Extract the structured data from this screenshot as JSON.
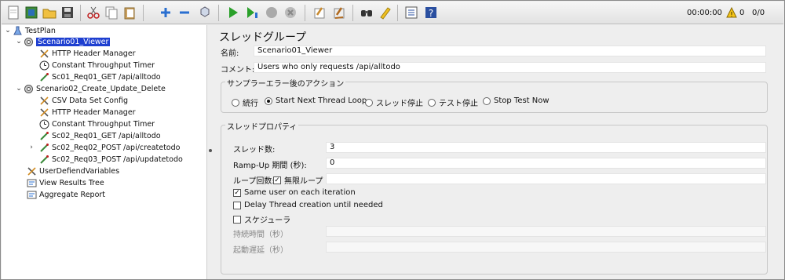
{
  "toolbar": {
    "buttons": [
      {
        "name": "new-icon"
      },
      {
        "name": "templates-icon"
      },
      {
        "name": "open-icon"
      },
      {
        "name": "save-icon"
      },
      {
        "name": "cut-icon"
      },
      {
        "name": "copy-icon"
      },
      {
        "name": "paste-icon"
      },
      {
        "name": "expand-icon"
      },
      {
        "name": "collapse-icon"
      },
      {
        "name": "toggle-icon"
      },
      {
        "name": "start-icon"
      },
      {
        "name": "start-no-pauses-icon"
      },
      {
        "name": "stop-icon"
      },
      {
        "name": "shutdown-icon"
      },
      {
        "name": "clear-icon"
      },
      {
        "name": "clear-all-icon"
      },
      {
        "name": "search-icon"
      },
      {
        "name": "reset-search-icon"
      },
      {
        "name": "function-helper-icon"
      },
      {
        "name": "help-icon"
      }
    ],
    "timer": "00:00:00",
    "warning_count": "0",
    "threads": "0/0"
  },
  "tree": {
    "nodes": [
      {
        "label": "TestPlan",
        "icon": "test-plan-icon"
      },
      {
        "label": "Scenario01_Viewer",
        "icon": "thread-group-icon"
      },
      {
        "label": "HTTP Header Manager",
        "icon": "config-element-icon"
      },
      {
        "label": "Constant Throughput Timer",
        "icon": "timer-icon"
      },
      {
        "label": "Sc01_Req01_GET /api/alltodo",
        "icon": "sampler-icon"
      },
      {
        "label": "Scenario02_Create_Update_Delete",
        "icon": "thread-group-icon"
      },
      {
        "label": "CSV Data Set Config",
        "icon": "config-element-icon"
      },
      {
        "label": "HTTP Header Manager",
        "icon": "config-element-icon"
      },
      {
        "label": "Constant Throughput Timer",
        "icon": "timer-icon"
      },
      {
        "label": "Sc02_Req01_GET /api/alltodo",
        "icon": "sampler-icon"
      },
      {
        "label": "Sc02_Req02_POST /api/createtodo",
        "icon": "sampler-icon"
      },
      {
        "label": "Sc02_Req03_POST /api/updatetodo",
        "icon": "sampler-icon"
      },
      {
        "label": "UserDefiendVariables",
        "icon": "config-element-icon"
      },
      {
        "label": "View Results Tree",
        "icon": "listener-icon"
      },
      {
        "label": "Aggregate Report",
        "icon": "listener-icon"
      }
    ]
  },
  "panel": {
    "title": "スレッドグループ",
    "name_label": "名前:",
    "name_value": "Scenario01_Viewer",
    "comment_label": "コメント:",
    "comment_value": "Users who only requests /api/alltodo",
    "error_group": {
      "title": "サンプラーエラー後のアクション",
      "options": [
        "続行",
        "Start Next Thread Loop",
        "スレッド停止",
        "テスト停止",
        "Stop Test Now"
      ],
      "selected": "Start Next Thread Loop"
    },
    "thread_group": {
      "title": "スレッドプロパティ",
      "threads_label": "スレッド数:",
      "threads_value": "3",
      "rampup_label": "Ramp-Up 期間 (秒):",
      "rampup_value": "0",
      "loop_label": "ループ回数:",
      "infinite_label": "無限ループ",
      "same_user_label": "Same user on each iteration",
      "delay_label": "Delay Thread creation until needed",
      "scheduler_label": "スケジューラ",
      "duration_label": "持続時間（秒）",
      "delay_startup_label": "起動遅延（秒）"
    }
  }
}
